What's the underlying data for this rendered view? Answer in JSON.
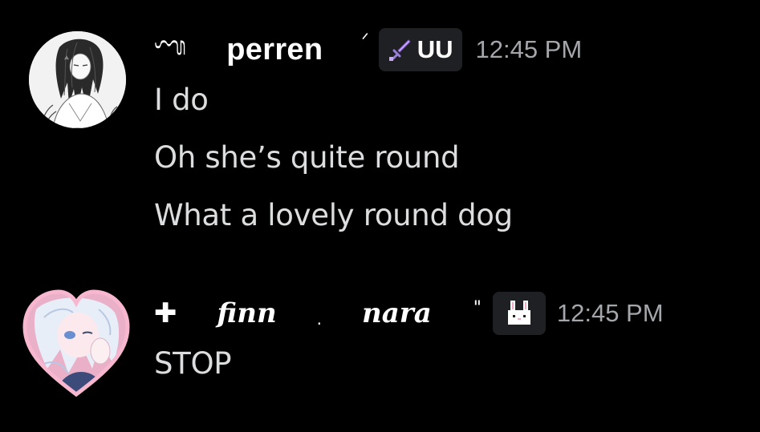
{
  "messages": [
    {
      "prefix_glyph": "ᬡ",
      "username": "perren",
      "decoration": "ᐟ",
      "tag_icon": "sword-icon",
      "tag_text": "UU",
      "timestamp": "12:45 PM",
      "lines": [
        "I do",
        "Oh she’s quite round",
        "What a lovely round dog"
      ]
    },
    {
      "prefix_glyph": "✚",
      "username_part1": "finn",
      "separator": ".",
      "username_part2": "nara",
      "decoration": "\"",
      "tag_icon": "bunny-icon",
      "timestamp": "12:45 PM",
      "lines": [
        "STOP"
      ]
    }
  ],
  "colors": {
    "background": "#000000",
    "message_text": "#dcddde",
    "timestamp": "#a3a6aa",
    "tag_bg": "#1f2023",
    "sword": "#c7a7ff"
  }
}
